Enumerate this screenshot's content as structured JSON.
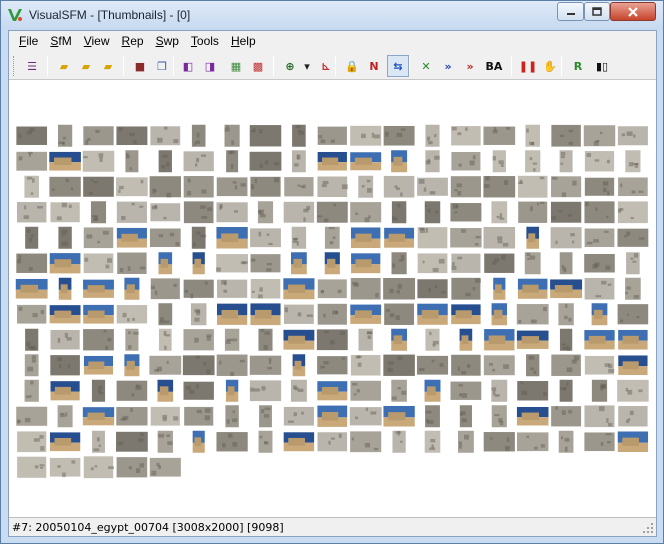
{
  "window": {
    "title": "VisualSFM - [Thumbnails] - [0]"
  },
  "menu": [
    {
      "label": "File",
      "name": "menu-file"
    },
    {
      "label": "SfM",
      "name": "menu-sfm"
    },
    {
      "label": "View",
      "name": "menu-view"
    },
    {
      "label": "Rep",
      "name": "menu-rep"
    },
    {
      "label": "Swp",
      "name": "menu-swp"
    },
    {
      "label": "Tools",
      "name": "menu-tools"
    },
    {
      "label": "Help",
      "name": "menu-help"
    }
  ],
  "toolbar": {
    "buttons": [
      {
        "name": "log-window-icon",
        "glyph": "☰",
        "color": "#6b2b7b"
      },
      {
        "name": "open-multi-images-icon",
        "glyph": "▰",
        "color": "#d8a400"
      },
      {
        "name": "add-images-icon",
        "glyph": "▰",
        "color": "#d8a400"
      },
      {
        "name": "open-folder-icon",
        "glyph": "▰",
        "color": "#d8a400"
      },
      {
        "name": "save-icon",
        "glyph": "■",
        "color": "#8b2a2a"
      },
      {
        "name": "copy-icon",
        "glyph": "❐",
        "color": "#3a5da8"
      },
      {
        "name": "previous-icon",
        "glyph": "◧",
        "color": "#7a2b9b"
      },
      {
        "name": "next-icon",
        "glyph": "◨",
        "color": "#7a2b9b"
      },
      {
        "name": "sift-icon",
        "glyph": "▦",
        "color": "#3c8a3c"
      },
      {
        "name": "thumbnail-grid-icon",
        "glyph": "▩",
        "color": "#c03030"
      },
      {
        "name": "zoom-icon",
        "glyph": "⊕",
        "color": "#2a6a2a"
      },
      {
        "name": "dropdown-arrow-icon",
        "glyph": "▾",
        "color": "#222222"
      },
      {
        "name": "axes-icon",
        "glyph": "⊾",
        "color": "#c03030"
      },
      {
        "name": "lock-icon",
        "glyph": "🔒",
        "color": "#2e8a2e"
      },
      {
        "name": "match-icon",
        "glyph": "N",
        "color": "#c02020"
      },
      {
        "name": "pair-icon",
        "glyph": "⇆",
        "color": "#2050c0"
      },
      {
        "name": "compute-missing-match-icon",
        "glyph": "✕",
        "color": "#2a8a2a"
      },
      {
        "name": "sparse-reconstruction-icon",
        "glyph": "»",
        "color": "#2040c0"
      },
      {
        "name": "sparse-reconstruction-plus-icon",
        "glyph": "»",
        "color": "#c02020"
      },
      {
        "name": "ba-icon",
        "glyph": "BA",
        "color": "#111111"
      },
      {
        "name": "pause-icon",
        "glyph": "❚❚",
        "color": "#d02020"
      },
      {
        "name": "hand-icon",
        "glyph": "✋",
        "color": "#888888"
      },
      {
        "name": "rotate-icon",
        "glyph": "R",
        "color": "#2a8a2a"
      },
      {
        "name": "dense-icon",
        "glyph": "▮▯",
        "color": "#111111"
      }
    ]
  },
  "status": {
    "text": "#7: 20050104_egypt_00704 [3008x2000] [9098]"
  },
  "colors": {
    "stone_light": "#b9b5ac",
    "stone_mid": "#9c978d",
    "stone_dark": "#7d786f",
    "sand": "#c9a97a",
    "sky": "#3d6fb2",
    "sky_deep": "#274f90"
  }
}
